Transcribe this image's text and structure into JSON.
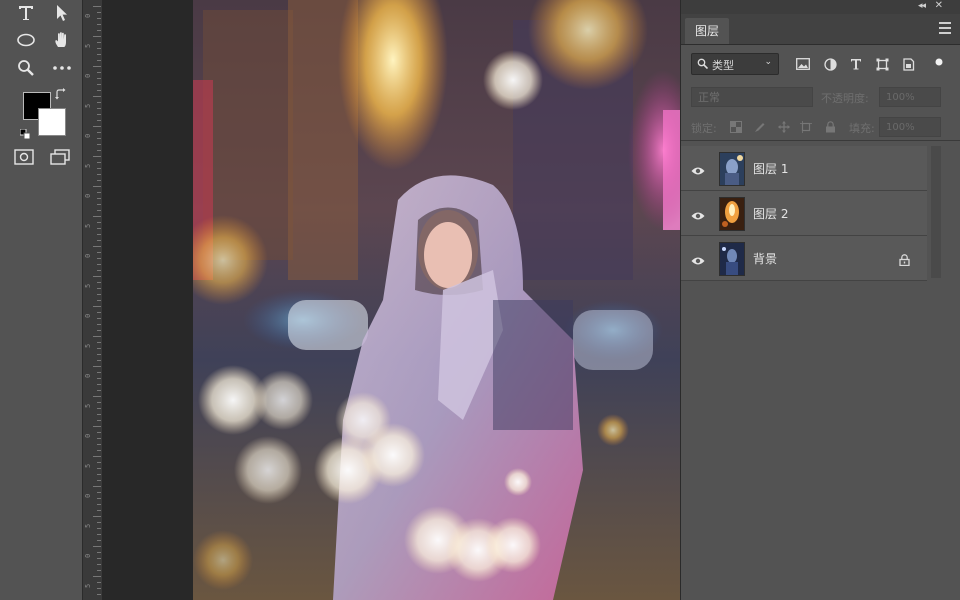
{
  "toolbar": {
    "tools": [
      {
        "name": "type-tool",
        "icon": "type-icon"
      },
      {
        "name": "move-tool",
        "icon": "arrow-icon"
      },
      {
        "name": "ellipse-tool",
        "icon": "ellipse-icon"
      },
      {
        "name": "hand-tool",
        "icon": "hand-icon"
      },
      {
        "name": "zoom-tool",
        "icon": "magnifier-icon"
      },
      {
        "name": "more-tools",
        "icon": "ellipsis-icon"
      },
      {
        "name": "quick-mask",
        "icon": "quick-mask-icon"
      },
      {
        "name": "screen-mode",
        "icon": "screen-mode-icon"
      }
    ],
    "foreground_color": "#000000",
    "background_color": "#ffffff"
  },
  "ruler": {
    "labels": [
      "0",
      "5",
      "0",
      "5",
      "0",
      "5",
      "0",
      "5",
      "0",
      "5",
      "0",
      "5",
      "0",
      "5",
      "0",
      "5",
      "0",
      "5",
      "0",
      "5"
    ]
  },
  "panel": {
    "tab_label": "图层",
    "filter": {
      "label": "类型",
      "icons": [
        "image-filter-icon",
        "adjustment-filter-icon",
        "type-filter-icon",
        "shape-filter-icon",
        "smart-object-filter-icon"
      ]
    },
    "blend_mode": "正常",
    "opacity_label": "不透明度:",
    "opacity_value": "100%",
    "lock_label": "锁定:",
    "fill_label": "填充:",
    "fill_value": "100%",
    "layers": [
      {
        "name": "图层 1",
        "locked": false,
        "visible": true
      },
      {
        "name": "图层 2",
        "locked": false,
        "visible": true
      },
      {
        "name": "背景",
        "locked": true,
        "visible": true
      }
    ]
  },
  "colors": {
    "ui_gray": "#535353",
    "pasteboard": "#282828",
    "panel_dark": "#3d3d3d"
  }
}
